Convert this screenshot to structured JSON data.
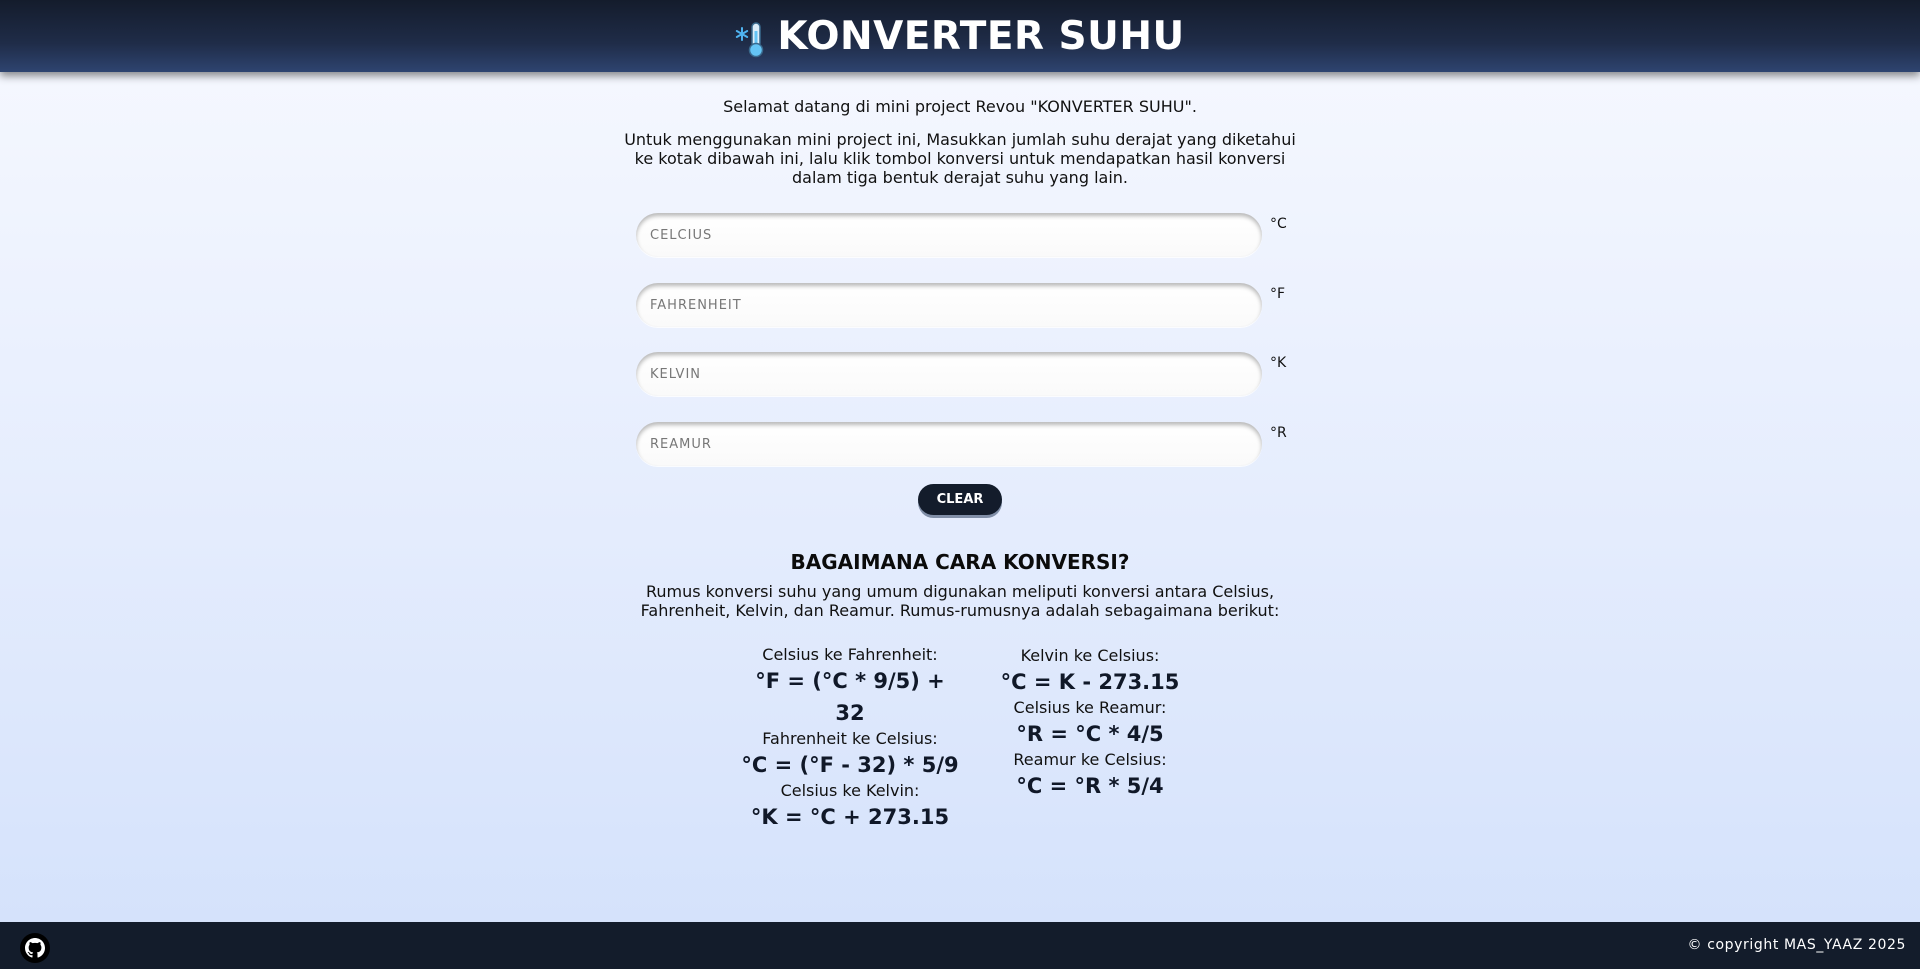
{
  "header": {
    "title": "KONVERTER SUHU",
    "icon": "snowflake-thermometer-icon"
  },
  "intro": {
    "welcome": "Selamat datang di mini project Revou \"KONVERTER SUHU\".",
    "instructions": "Untuk menggunakan mini project ini, Masukkan jumlah suhu derajat yang diketahui ke kotak dibawah ini, lalu klik tombol konversi untuk mendapatkan hasil konversi dalam tiga bentuk derajat suhu yang lain."
  },
  "fields": [
    {
      "placeholder": "CELCIUS",
      "value": "",
      "unit": "°C"
    },
    {
      "placeholder": "FAHRENHEIT",
      "value": "",
      "unit": "°F"
    },
    {
      "placeholder": "KELVIN",
      "value": "",
      "unit": "°K"
    },
    {
      "placeholder": "REAMUR",
      "value": "",
      "unit": "°R"
    }
  ],
  "clear_label": "CLEAR",
  "howto": {
    "title": "BAGAIMANA CARA KONVERSI?",
    "description": "Rumus konversi suhu yang umum digunakan meliputi konversi antara Celsius, Fahrenheit, Kelvin, dan Reamur. Rumus-rumusnya adalah sebagaimana berikut:",
    "left": [
      {
        "label": "Celsius ke Fahrenheit:",
        "formula": "°F = (°C * 9/5) + 32"
      },
      {
        "label": "Fahrenheit ke Celsius:",
        "formula": "°C = (°F - 32) * 5/9"
      },
      {
        "label": "Celsius ke Kelvin:",
        "formula": "°K = °C + 273.15"
      }
    ],
    "right": [
      {
        "label": "Kelvin ke Celsius:",
        "formula": "°C = K - 273.15"
      },
      {
        "label": "Celsius ke Reamur:",
        "formula": "°R = °C * 4/5"
      },
      {
        "label": "Reamur ke Celsius:",
        "formula": "°C = °R * 5/4"
      }
    ]
  },
  "footer": {
    "github_icon": "github-icon",
    "copyright": "© copyright MAS_YAAZ 2025"
  },
  "colors": {
    "header_bg": "#1f2c48",
    "footer_bg": "#131c2b",
    "button_bg": "#131c2b",
    "icon_snowflake": "#4fb3f0",
    "icon_thermometer": "#64c4f5"
  }
}
